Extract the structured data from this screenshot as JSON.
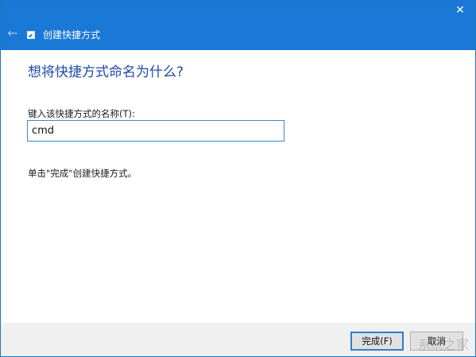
{
  "window": {
    "title": "创建快捷方式",
    "back_glyph": "←",
    "close_glyph": "✕"
  },
  "content": {
    "heading": "想将快捷方式命名为什么?",
    "field_label": "键入该快捷方式的名称(T):",
    "name_value": "cmd",
    "hint": "单击\"完成\"创建快捷方式。"
  },
  "footer": {
    "finish_label": "完成(F)",
    "cancel_label": "取消"
  },
  "watermark": {
    "text": "系统之家"
  },
  "colors": {
    "titlebar": "#1a78d6",
    "heading": "#1f4aa8",
    "input_border": "#3c88d3"
  },
  "icons": {
    "back": "back-arrow-icon",
    "app": "shortcut-icon",
    "close": "close-icon"
  }
}
